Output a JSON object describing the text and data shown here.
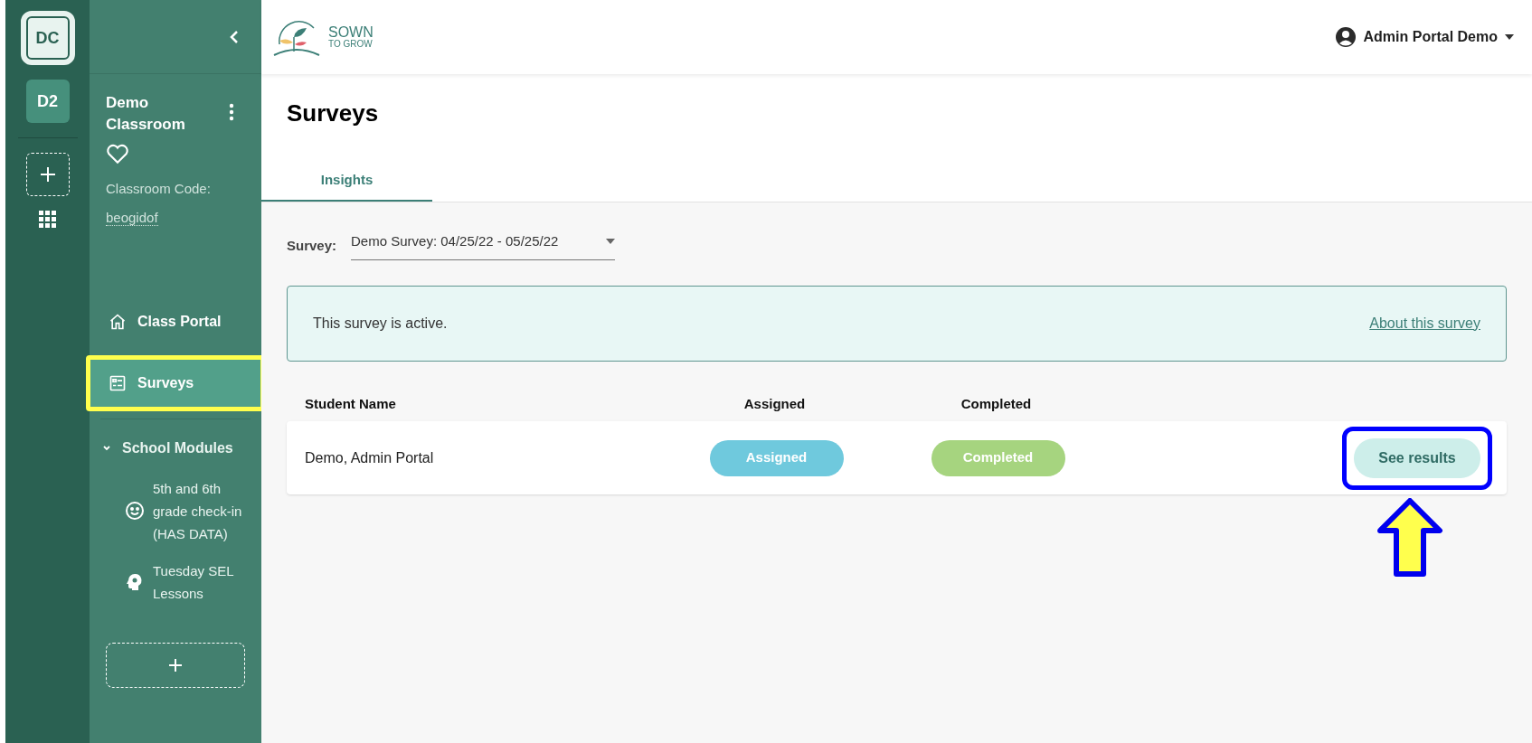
{
  "rail": {
    "classes": [
      {
        "label": "DC",
        "selected": true
      },
      {
        "label": "D2",
        "selected": false
      }
    ]
  },
  "sidebar": {
    "classroom_name": "Demo Classroom",
    "code_label": "Classroom Code:",
    "code": "beogidof",
    "nav": [
      {
        "label": "Class Portal",
        "selected": false,
        "highlighted": false
      },
      {
        "label": "Surveys",
        "selected": true,
        "highlighted": true
      }
    ],
    "modules_section": {
      "label": "School Modules",
      "expanded": true,
      "items": [
        {
          "label": "5th and 6th grade check-in (HAS DATA)"
        },
        {
          "label": "Tuesday SEL Lessons"
        }
      ]
    }
  },
  "header": {
    "logo_top": "SOWN",
    "logo_bottom": "TO GROW",
    "user": "Admin Portal Demo"
  },
  "page": {
    "title": "Surveys",
    "tabs": [
      {
        "label": "Insights",
        "selected": true
      }
    ],
    "survey_label": "Survey:",
    "survey_value": "Demo Survey: 04/25/22 - 05/25/22",
    "banner": {
      "text": "This survey is active.",
      "link": "About this survey"
    },
    "table": {
      "columns": [
        "Student Name",
        "Assigned",
        "Completed"
      ],
      "rows": [
        {
          "name": "Demo, Admin Portal",
          "assigned": "Assigned",
          "completed": "Completed",
          "action": "See results",
          "action_highlighted": true
        }
      ]
    }
  }
}
